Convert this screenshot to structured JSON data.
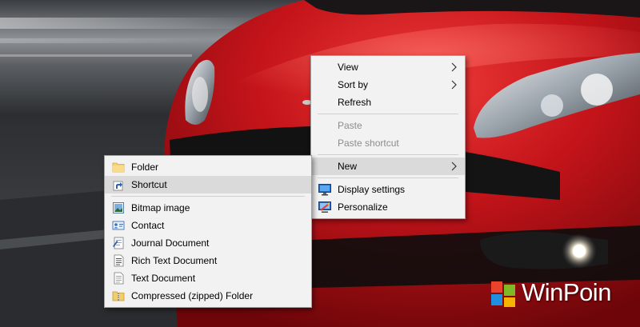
{
  "desktop_menu": {
    "view": "View",
    "sort_by": "Sort by",
    "refresh": "Refresh",
    "paste": "Paste",
    "paste_shortcut": "Paste shortcut",
    "new": "New",
    "display_settings": "Display settings",
    "personalize": "Personalize"
  },
  "new_submenu": {
    "folder": "Folder",
    "shortcut": "Shortcut",
    "bitmap_image": "Bitmap image",
    "contact": "Contact",
    "journal_document": "Journal Document",
    "rich_text_document": "Rich Text Document",
    "text_document": "Text Document",
    "compressed_folder": "Compressed (zipped) Folder"
  },
  "watermark": {
    "text": "WinPoin"
  },
  "colors": {
    "menu_bg": "#f2f2f2",
    "menu_hover": "#dadada",
    "disabled_text": "#8c8c8c",
    "car_red": "#c4141a"
  }
}
